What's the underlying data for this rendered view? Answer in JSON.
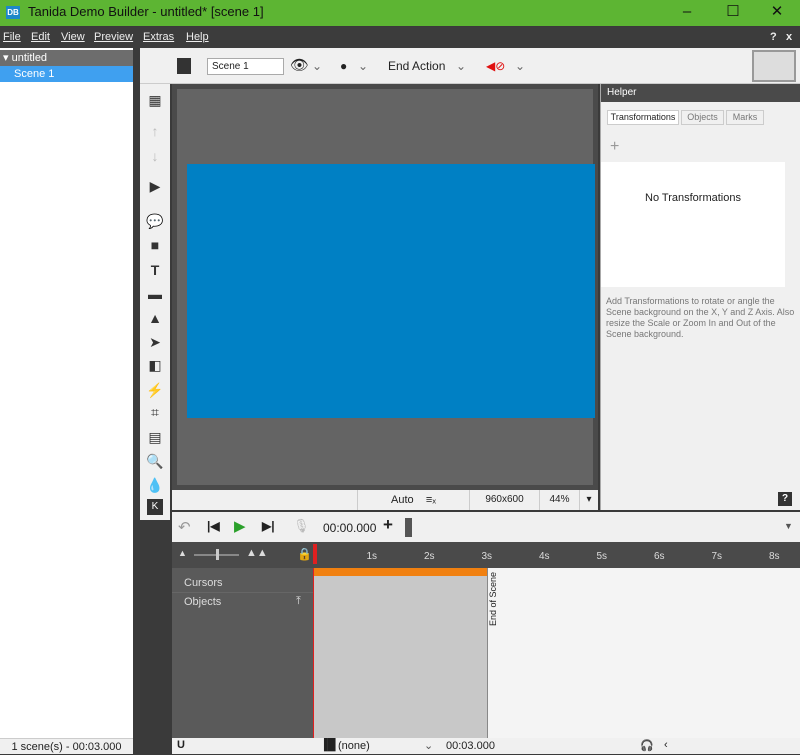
{
  "window": {
    "title": "Tanida Demo Builder - untitled* [scene 1]",
    "logo": "DB",
    "minimize": "–",
    "maximize": "☐",
    "close": "✕"
  },
  "menu": {
    "items": [
      "File",
      "Edit",
      "View",
      "Preview",
      "Extras",
      "Help"
    ],
    "help": "?",
    "close": "x"
  },
  "tree": {
    "project": "untitled",
    "scene": "Scene 1"
  },
  "left_status": "1 scene(s) - 00:03.000",
  "toolbar": {
    "scene_name": "Scene 1",
    "end_action": "End Action"
  },
  "canvas": {
    "background_color": "#0080c4",
    "mode": "Auto",
    "resolution": "960x600",
    "zoom": "44%"
  },
  "helper": {
    "title": "Helper",
    "tabs": [
      "Transformations",
      "Objects",
      "Marks"
    ],
    "add": "+",
    "empty": "No Transformations",
    "description": "Add Transformations to rotate or angle the Scene background on the X, Y and Z Axis. Also resize the Scale or Zoom In and Out of the Scene background.",
    "help": "?"
  },
  "timeline": {
    "time": "00:00.000",
    "ticks": [
      "1s",
      "2s",
      "3s",
      "4s",
      "5s",
      "6s",
      "7s",
      "8s"
    ],
    "tracks": [
      "Cursors",
      "Objects"
    ],
    "end_label": "End of Scene",
    "scene_duration_s": 3,
    "cursor_value": "(none)",
    "end_time": "00:03.000"
  }
}
